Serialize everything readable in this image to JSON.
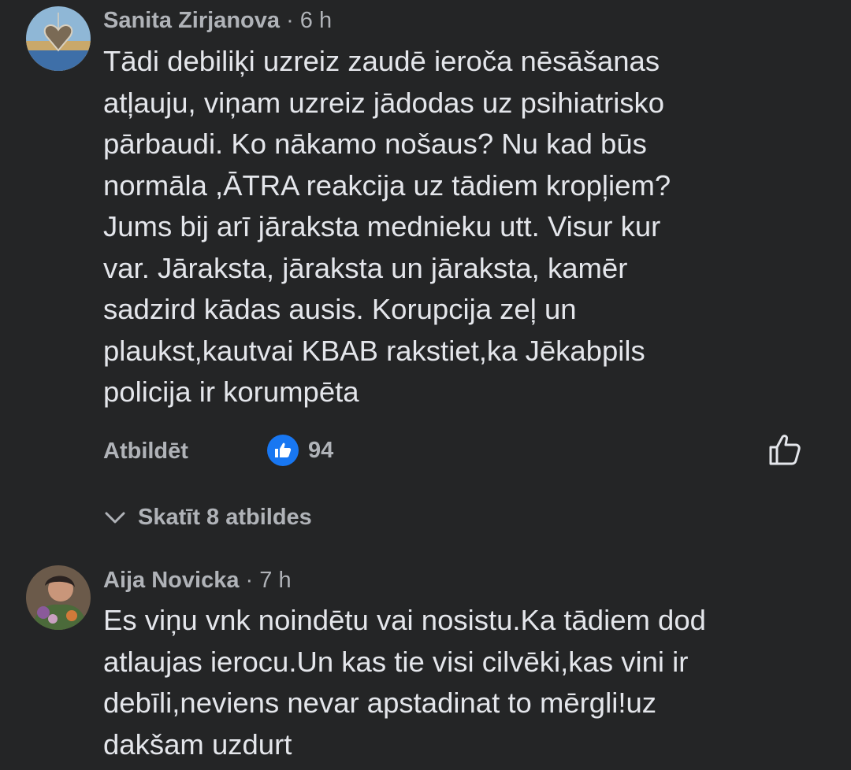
{
  "comments": [
    {
      "author": "Sanita Zirjanova",
      "time": "· 6 h",
      "text": "Tādi debiliķi uzreiz zaudē ieroča nēsāšanas\natļauju, viņam uzreiz jādodas uz psihiatrisko\npārbaudi.  Ko nākamo nošaus?  Nu kad būs\nnormāla ,ĀTRA reakcija uz tādiem kropļiem?\nJums bij arī jāraksta mednieku utt. Visur kur\nvar. Jāraksta, jāraksta un jāraksta, kamēr\nsadzird kādas ausis. Korupcija zeļ un\nplaukst,kautvai KBAB rakstiet,ka Jēkabpils\npolicija ir korumpēta",
      "reply_label": "Atbildēt",
      "reaction_count": "94",
      "reaction_icon": "like-icon",
      "view_replies_label": "Skatīt 8 atbildes"
    },
    {
      "author": "Aija Novicka",
      "time": "· 7 h",
      "text": "Es viņu vnk noindētu vai nosistu.Ka tādiem dod\natlaujas ierocu.Un kas tie visi cilvēki,kas vini ir\ndebīli,neviens nevar apstadinat to mērgli!uz\ndakšam uzdurt"
    }
  ],
  "colors": {
    "background": "#242526",
    "text_primary": "#e4e6eb",
    "text_secondary": "#b0b3b8",
    "like_blue": "#1877f2"
  }
}
